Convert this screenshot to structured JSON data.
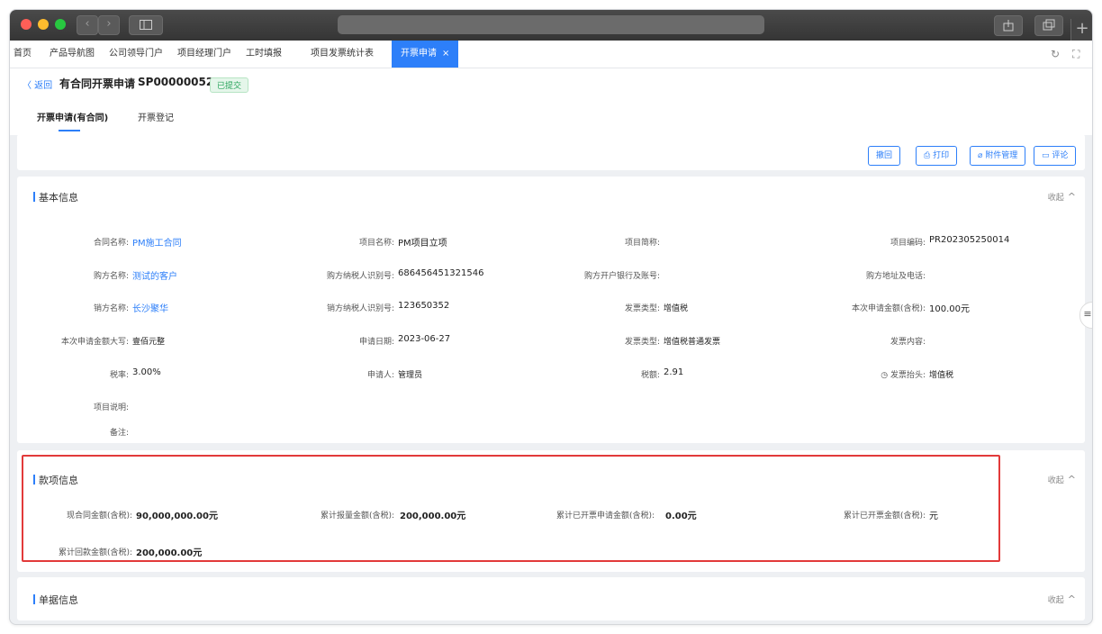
{
  "tabs": [
    "首页",
    "产品导航图",
    "公司领导门户",
    "项目经理门户",
    "工时填报",
    "项目发票统计表"
  ],
  "active_tab": {
    "label": "开票申请",
    "close": "×"
  },
  "header": {
    "back": "〈 返回",
    "title": "有合同开票申请",
    "doc_no": "SP00000052",
    "status": "已提交",
    "subtabs": [
      "开票申请(有合同)",
      "开票登记"
    ]
  },
  "actions": {
    "withdraw": "撤回",
    "print": "打印",
    "attachments": "附件管理",
    "comment": "评论"
  },
  "basic": {
    "title": "基本信息",
    "collapse": "收起",
    "fields": [
      {
        "label": "合同名称:",
        "value": "PM施工合同"
      },
      {
        "label": "项目名称:",
        "value": "PM项目立项"
      },
      {
        "label": "项目简称:",
        "value": ""
      },
      {
        "label": "项目编码:",
        "value": "PR202305250014"
      },
      {
        "label": "购方名称:",
        "value": "测试的客户"
      },
      {
        "label": "购方纳税人识别号:",
        "value": "686456451321546"
      },
      {
        "label": "购方开户银行及账号:",
        "value": ""
      },
      {
        "label": "购方地址及电话:",
        "value": ""
      },
      {
        "label": "销方名称:",
        "value": "长沙聚华"
      },
      {
        "label": "销方纳税人识别号:",
        "value": "123650352"
      },
      {
        "label": "发票类型:",
        "value": "增值税"
      },
      {
        "label": "本次申请金额(含税):",
        "value": "100.00元"
      },
      {
        "label": "本次申请金额大写:",
        "value": "壹佰元整"
      },
      {
        "label": "申请日期:",
        "value": "2023-06-27"
      },
      {
        "label": "发票类型:",
        "value": "增值税普通发票"
      },
      {
        "label": "发票内容:",
        "value": ""
      },
      {
        "label": "税率:",
        "value": "3.00%"
      },
      {
        "label": "申请人:",
        "value": "管理员"
      },
      {
        "label": "税额:",
        "value": "2.91"
      },
      {
        "label": "发票抬头:",
        "value": "增值税"
      },
      {
        "label": "项目说明:",
        "value": ""
      },
      {
        "label": "备注:",
        "value": ""
      }
    ]
  },
  "money": {
    "title": "款项信息",
    "collapse": "收起",
    "fields": [
      {
        "label": "现合同金额(含税):",
        "value": "90,000,000.00元"
      },
      {
        "label": "累计报量金额(含税):",
        "value": "200,000.00元"
      },
      {
        "label": "累计已开票申请金额(含税):",
        "value": "0.00元"
      },
      {
        "label": "累计已开票金额(含税):",
        "value": "元"
      },
      {
        "label": "累计回款金额(含税):",
        "value": "200,000.00元"
      }
    ]
  },
  "doc": {
    "title": "单据信息",
    "collapse": "收起"
  },
  "colors": {
    "accent": "#2d7ff9",
    "highlight": "#e23a3a",
    "status_green": "#27a35a"
  }
}
